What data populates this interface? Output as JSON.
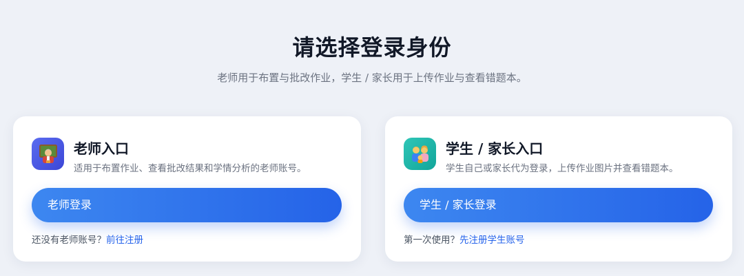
{
  "header": {
    "title": "请选择登录身份",
    "subtitle": "老师用于布置与批改作业，学生 / 家长用于上传作业与查看错题本。"
  },
  "cards": {
    "teacher": {
      "icon": "teacher-icon",
      "title": "老师入口",
      "description": "适用于布置作业、查看批改结果和学情分析的老师账号。",
      "button_label": "老师登录",
      "footer_prompt": "还没有老师账号？",
      "footer_link": "前往注册"
    },
    "student": {
      "icon": "family-icon",
      "title": "学生 / 家长入口",
      "description": "学生自己或家长代为登录，上传作业图片并查看错题本。",
      "button_label": "学生 / 家长登录",
      "footer_prompt": "第一次使用？",
      "footer_link": "先注册学生账号"
    }
  },
  "colors": {
    "background": "#eef1f7",
    "accent": "#2563eb",
    "teacher_icon_bg": "#4650e0",
    "student_icon_bg": "#1fb5a8"
  }
}
